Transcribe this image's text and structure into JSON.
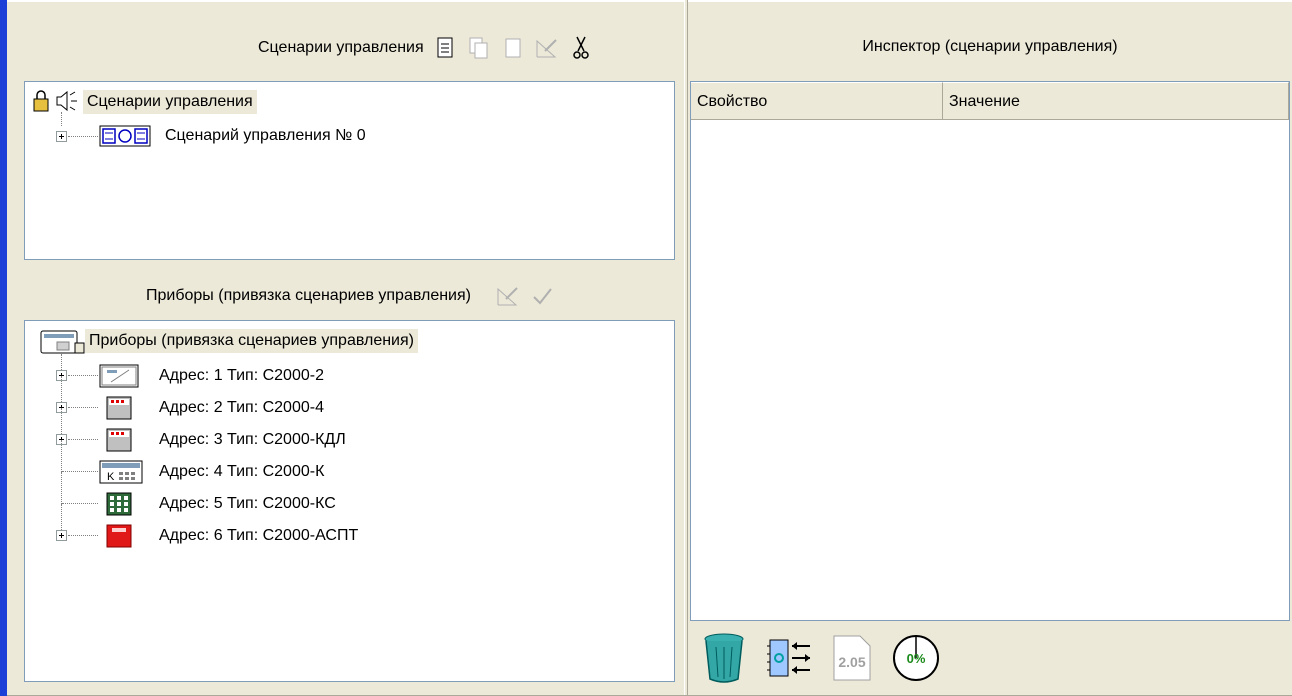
{
  "scenarios_panel": {
    "header_title": "Сценарии управления",
    "tree_root": "Сценарии управления",
    "items": [
      {
        "label": "Сценарий управления № 0"
      }
    ]
  },
  "devices_panel": {
    "header_title": "Приборы  (привязка сценариев управления)",
    "tree_root": "Приборы (привязка сценариев управления)",
    "items": [
      {
        "label": "Адрес: 1 Тип: С2000-2",
        "icon": "panel-keypad-icon",
        "expandable": true
      },
      {
        "label": "Адрес: 2 Тип: С2000-4",
        "icon": "gray-module-icon",
        "expandable": true
      },
      {
        "label": "Адрес: 3 Тип: С2000-КДЛ",
        "icon": "gray-module-icon",
        "expandable": true
      },
      {
        "label": "Адрес: 4 Тип: С2000-К",
        "icon": "keyboard-icon",
        "expandable": false
      },
      {
        "label": "Адрес: 5 Тип: С2000-КС",
        "icon": "green-keypad-icon",
        "expandable": false
      },
      {
        "label": "Адрес: 6 Тип: С2000-АСПТ",
        "icon": "red-module-icon",
        "expandable": true
      }
    ]
  },
  "inspector": {
    "title": "Инспектор (сценарии управления)",
    "columns": [
      "Свойство",
      "Значение"
    ]
  },
  "bottom_tools": {
    "version_label": "2.05",
    "progress_label": "0%",
    "progress": 0
  },
  "colors": {
    "window_bg": "#ece9d8",
    "accent_strip": "#1c3fd8",
    "border": "#7f9db9"
  }
}
